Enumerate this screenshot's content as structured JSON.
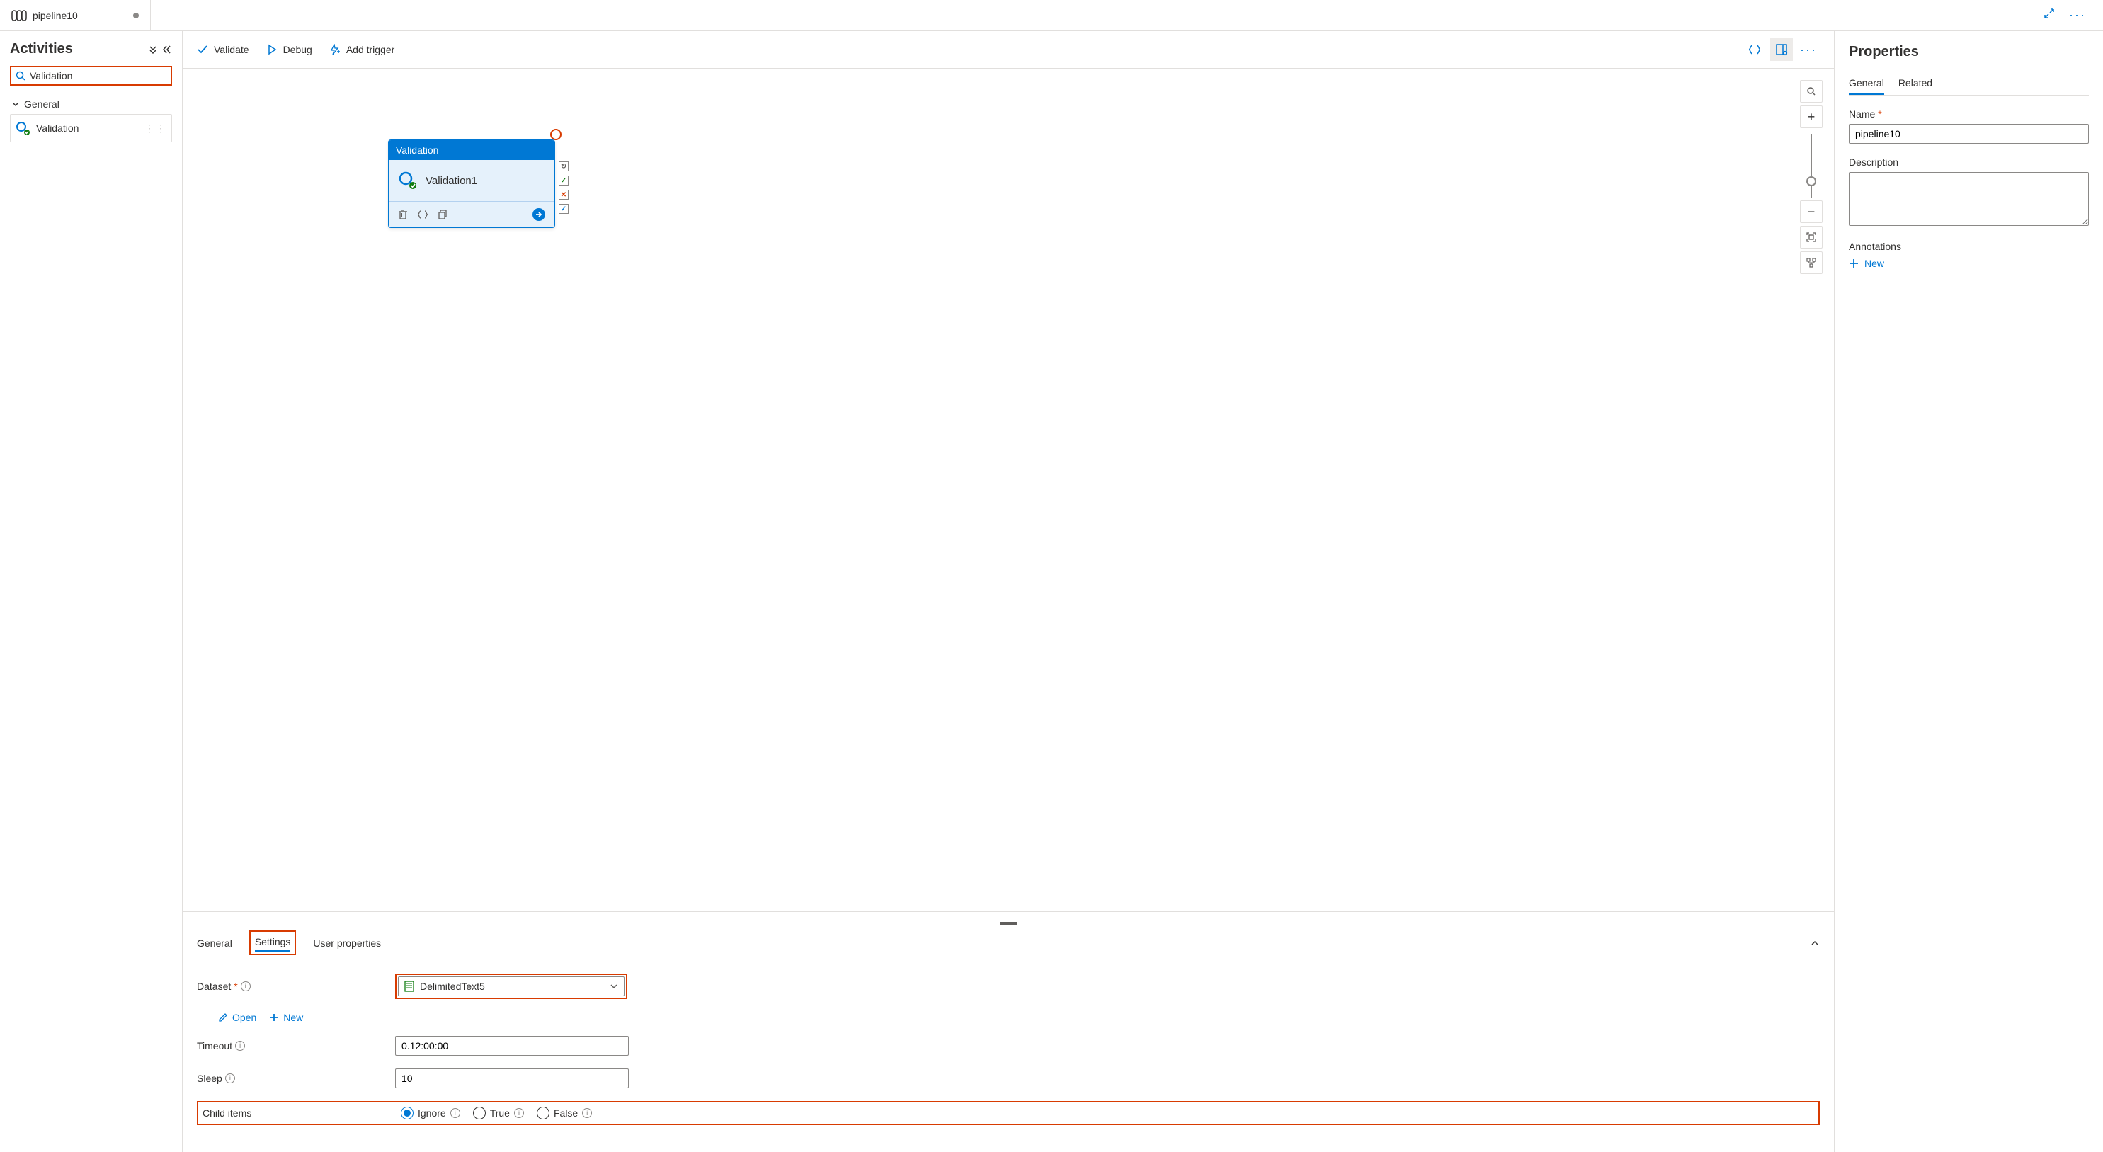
{
  "tab": {
    "title": "pipeline10"
  },
  "activities": {
    "heading": "Activities",
    "search_value": "Validation",
    "category": "General",
    "items": [
      "Validation"
    ]
  },
  "toolbar": {
    "validate": "Validate",
    "debug": "Debug",
    "add_trigger": "Add trigger"
  },
  "canvas": {
    "node": {
      "type": "Validation",
      "name": "Validation1"
    }
  },
  "settings_panel": {
    "tabs": {
      "general": "General",
      "settings": "Settings",
      "user_props": "User properties"
    },
    "dataset": {
      "label": "Dataset",
      "value": "DelimitedText5",
      "open": "Open",
      "new": "New"
    },
    "timeout": {
      "label": "Timeout",
      "value": "0.12:00:00"
    },
    "sleep": {
      "label": "Sleep",
      "value": "10"
    },
    "child_items": {
      "label": "Child items",
      "ignore": "Ignore",
      "true": "True",
      "false": "False",
      "selected": "Ignore"
    }
  },
  "properties": {
    "heading": "Properties",
    "tabs": {
      "general": "General",
      "related": "Related"
    },
    "name": {
      "label": "Name",
      "value": "pipeline10"
    },
    "description": {
      "label": "Description",
      "value": ""
    },
    "annotations": {
      "label": "Annotations",
      "new": "New"
    }
  }
}
